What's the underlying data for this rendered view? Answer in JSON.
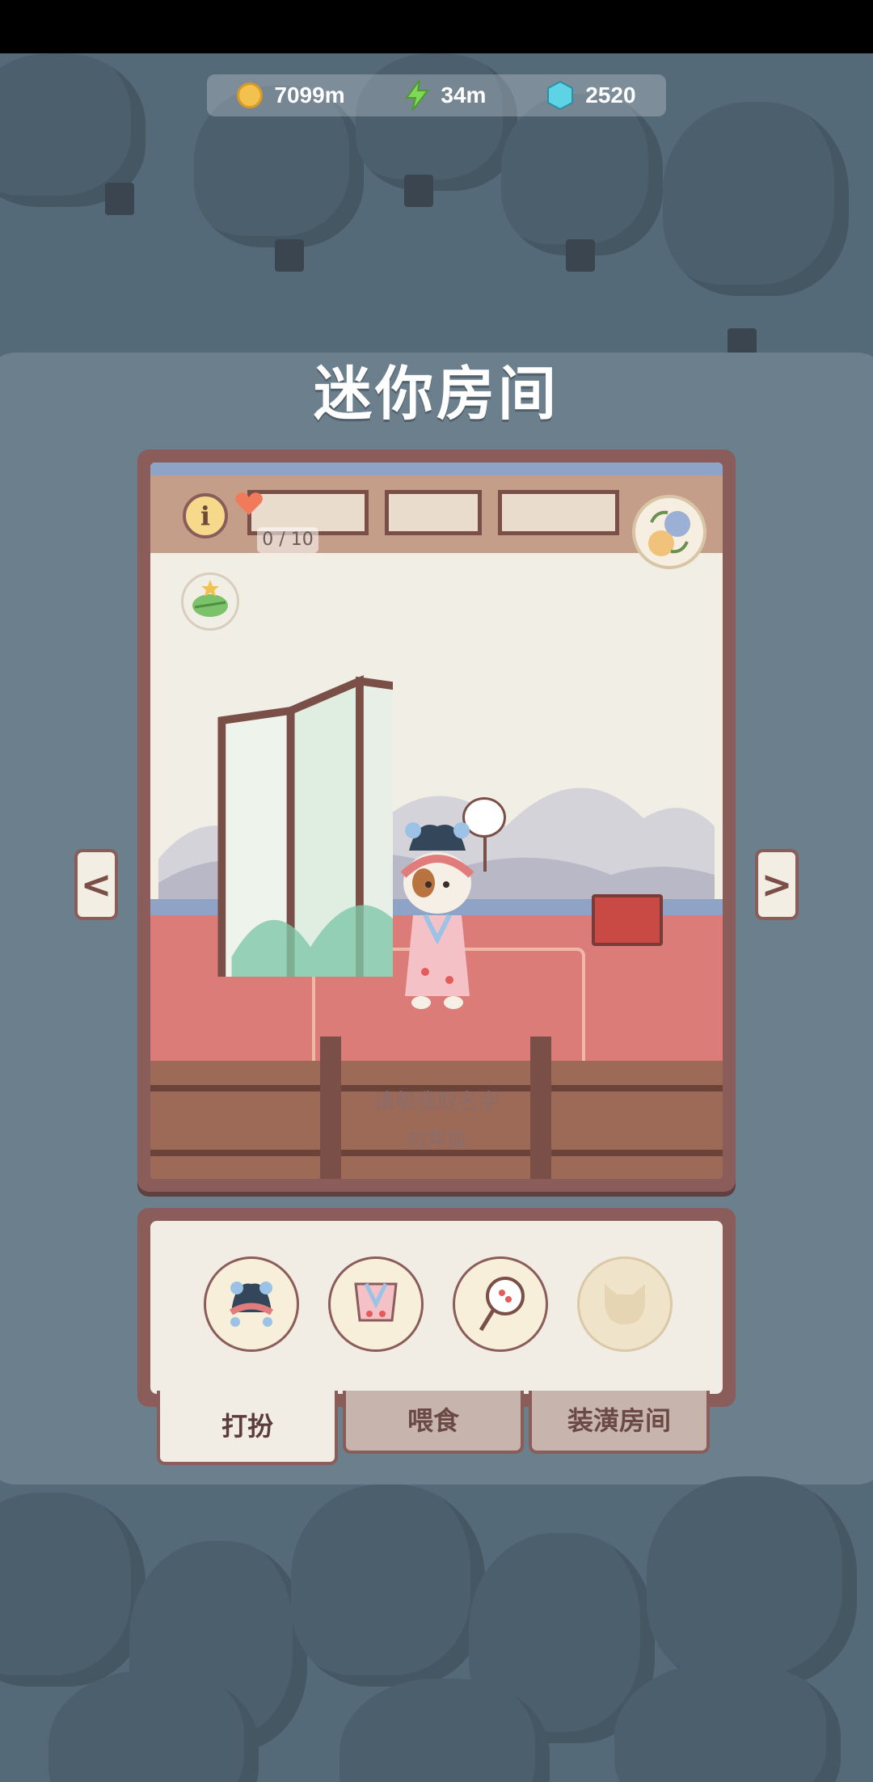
{
  "currency": {
    "coins": "7099m",
    "energy": "34m",
    "gems": "2520"
  },
  "page": {
    "title": "迷你房间"
  },
  "room": {
    "love_count": "0 / 10",
    "name_prompt": "请帮我取名字",
    "breed": "拉邦猫",
    "prev_symbol": "<",
    "next_symbol": ">"
  },
  "info_label": "i",
  "tabs": [
    {
      "label": "打扮",
      "active": true
    },
    {
      "label": "喂食",
      "active": false
    },
    {
      "label": "装潢房间",
      "active": false
    }
  ],
  "items": [
    {
      "icon": "opera-headdress-icon"
    },
    {
      "icon": "pink-robe-icon"
    },
    {
      "icon": "round-fan-icon"
    },
    {
      "icon": "empty-slot-icon"
    }
  ],
  "colors": {
    "frame": "#8a5c5a",
    "floor": "#dc7c78",
    "accent_coin": "#f2c14e",
    "accent_energy": "#7ed957",
    "accent_gem": "#5fd3e6"
  }
}
